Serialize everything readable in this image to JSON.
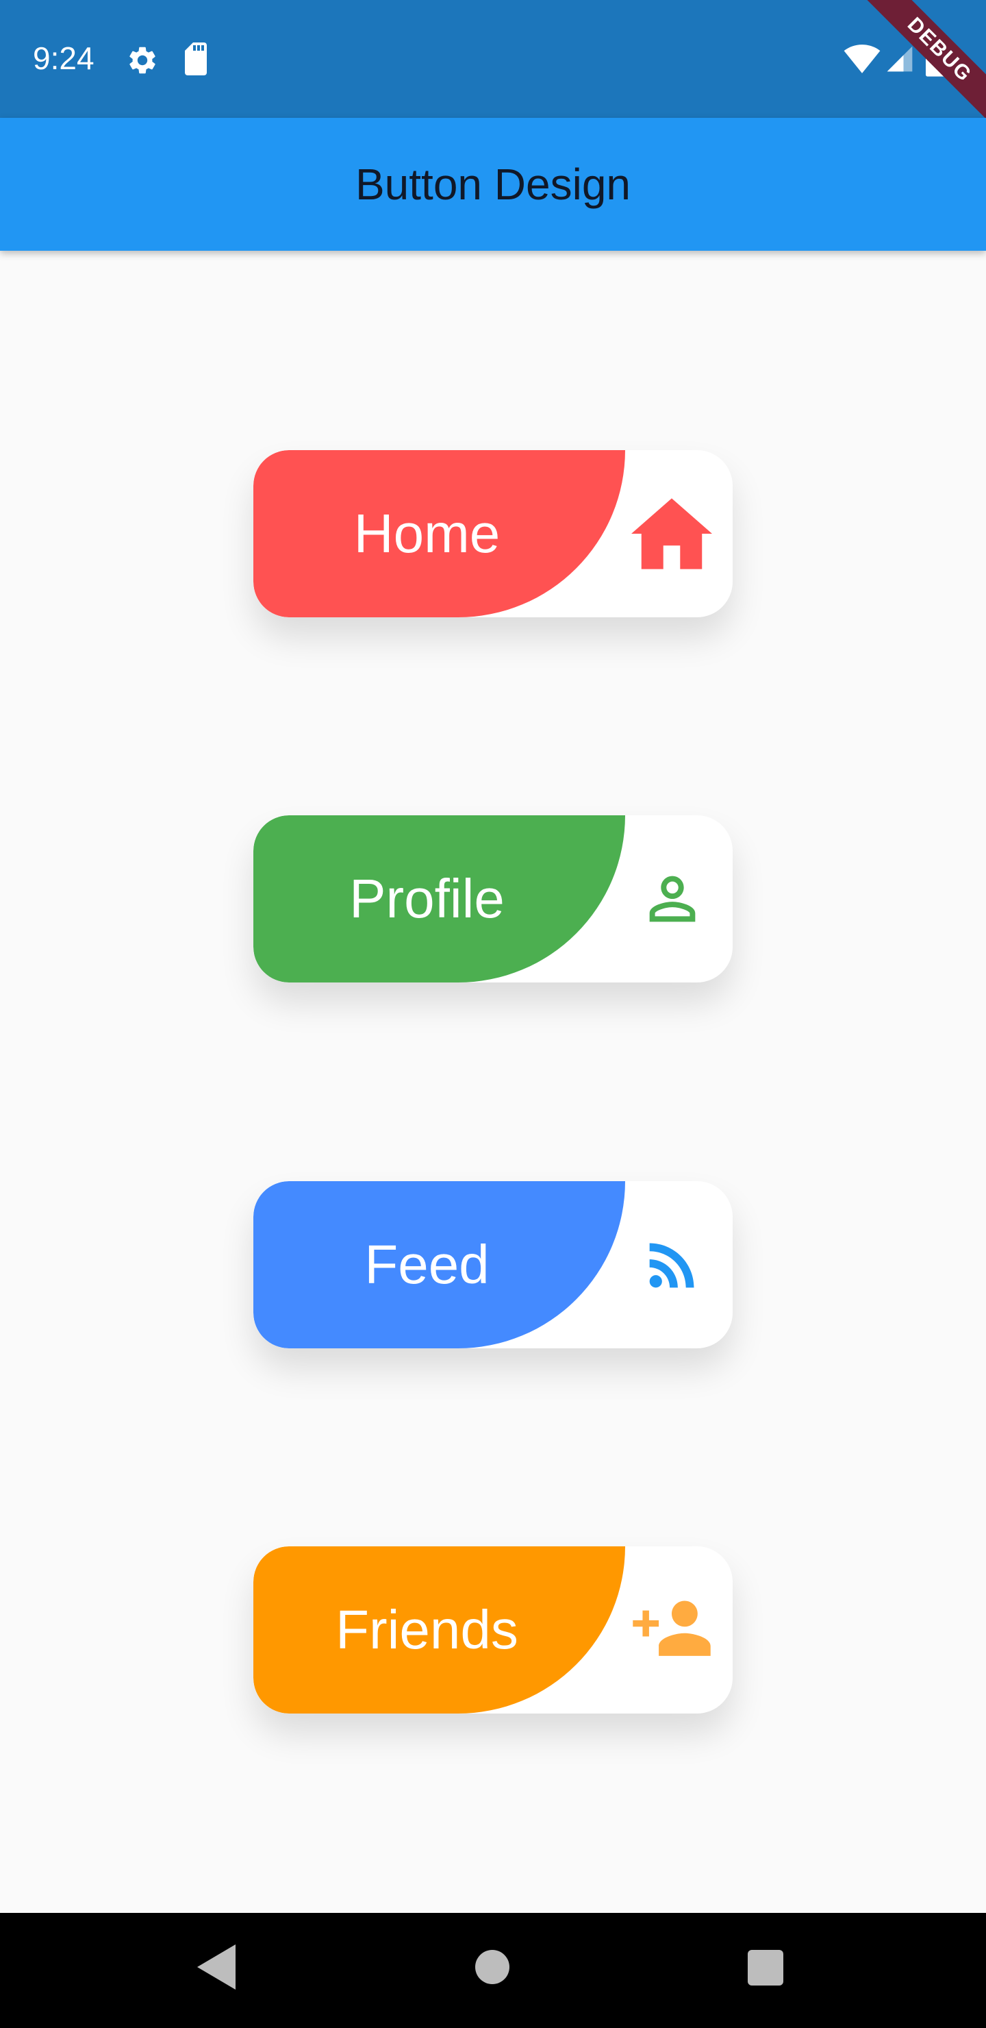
{
  "status_bar": {
    "time": "9:24",
    "icons": [
      "gear-icon",
      "sd-card-icon",
      "wifi-icon",
      "signal-icon",
      "battery-icon"
    ],
    "background": "#1c76bb"
  },
  "debug_ribbon": {
    "label": "DEBUG"
  },
  "app_bar": {
    "title": "Button Design",
    "background": "#2196f3"
  },
  "buttons": [
    {
      "label": "Home",
      "icon": "home-icon",
      "color": "#ff5252"
    },
    {
      "label": "Profile",
      "icon": "person-icon",
      "color": "#4caf50"
    },
    {
      "label": "Feed",
      "icon": "rss-feed-icon",
      "color": "#448aff"
    },
    {
      "label": "Friends",
      "icon": "person-add-icon",
      "color": "#ff9800"
    }
  ],
  "nav_bar": {
    "icons": [
      "back-icon",
      "home-icon",
      "recents-icon"
    ]
  }
}
